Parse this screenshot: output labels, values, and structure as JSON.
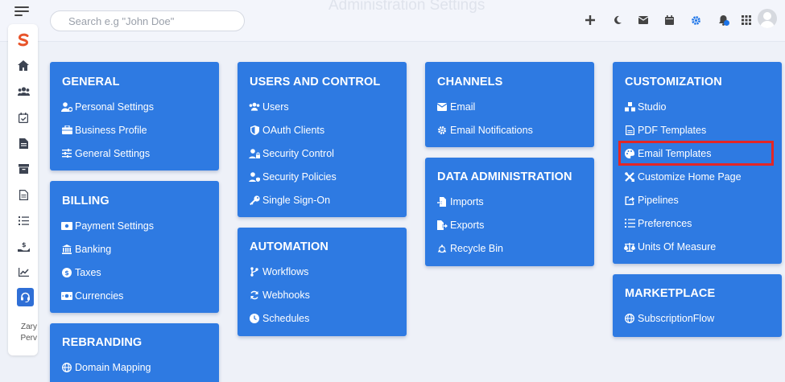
{
  "search": {
    "placeholder": "Search e.g \"John Doe\""
  },
  "header": {
    "ghost_title": "Administration Settings"
  },
  "user": {
    "first": "Zary",
    "last": "Perv"
  },
  "cards": {
    "general": {
      "title": "GENERAL",
      "items": [
        "Personal Settings",
        "Business Profile",
        "General Settings"
      ]
    },
    "billing": {
      "title": "BILLING",
      "items": [
        "Payment Settings",
        "Banking",
        "Taxes",
        "Currencies"
      ]
    },
    "rebranding": {
      "title": "REBRANDING",
      "items": [
        "Domain Mapping"
      ]
    },
    "users": {
      "title": "USERS AND CONTROL",
      "items": [
        "Users",
        "OAuth Clients",
        "Security Control",
        "Security Policies",
        "Single Sign-On"
      ]
    },
    "automation": {
      "title": "AUTOMATION",
      "items": [
        "Workflows",
        "Webhooks",
        "Schedules"
      ]
    },
    "channels": {
      "title": "CHANNELS",
      "items": [
        "Email",
        "Email Notifications"
      ]
    },
    "data_admin": {
      "title": "DATA ADMINISTRATION",
      "items": [
        "Imports",
        "Exports",
        "Recycle Bin"
      ]
    },
    "customization": {
      "title": "CUSTOMIZATION",
      "items": [
        "Studio",
        "PDF Templates",
        "Email Templates",
        "Customize Home Page",
        "Pipelines",
        "Preferences",
        "Units Of Measure"
      ]
    },
    "marketplace": {
      "title": "MARKETPLACE",
      "items": [
        "SubscriptionFlow"
      ]
    }
  },
  "colors": {
    "card": "#2e7ae2",
    "highlight": "#e32626",
    "accent": "#1a73e8"
  }
}
